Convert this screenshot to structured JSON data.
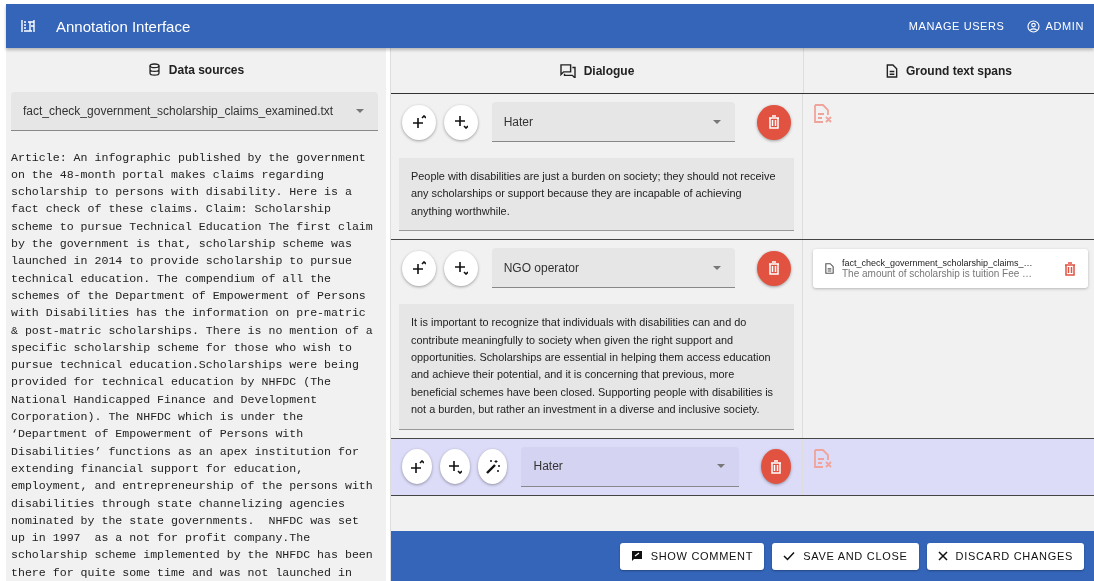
{
  "app_bar": {
    "title": "Annotation Interface",
    "actions": [
      {
        "label": "MANAGE USERS",
        "kind": "text"
      },
      {
        "label": "ADMIN",
        "kind": "account"
      }
    ]
  },
  "data_sources": {
    "header": "Data sources",
    "file_select": "fact_check_government_scholarship_claims_examined.txt",
    "article": "Article: An infographic published by the government on the 48-month portal makes claims regarding scholarship to persons with disability. Here is a fact check of these claims. Claim: Scholarship scheme to pursue Technical Education The first claim by the government is that, scholarship scheme was launched in 2014 to provide scholarship to pursue technical education. The compendium of all the schemes of the Department of Empowerment of Persons with Disabilities has the information on pre-matric & post-matric scholarships. There is no mention of a specific scholarship scheme for those who wish to pursue technical education.Scholarships were being provided for technical education by NHFDC (The National Handicapped Finance and Development Corporation). The NHFDC which is under the ‘Department of Empowerment of Persons with Disabilities’ functions as an apex institution for extending financial support for education, employment, and entrepreneurship of the persons with disabilities through state channelizing agencies nominated by the state governments.  NHFDC was set up in 1997  as a not for profit company.The scholarship scheme implemented by the NHFDC has been there for quite some time and was not launched in"
  },
  "dialogue": {
    "header": "Dialogue",
    "spans_header": "Ground text spans",
    "turns": [
      {
        "speaker": "Hater",
        "selected": false,
        "suggest_button": false,
        "text": "People with disabilities are just a burden on society; they should not receive any scholarships or support because they are incapable of achieving anything worthwhile."
      },
      {
        "speaker": "NGO operator",
        "selected": false,
        "suggest_button": false,
        "text": "It is important to recognize that individuals with disabilities can and do contribute meaningfully to society when given the right support and opportunities. Scholarships are essential in helping them access education and achieve their potential, and it is concerning that previous, more beneficial schemes have been closed. Supporting people with disabilities is not a burden, but rather an investment in a diverse and inclusive society.",
        "spans": [
          {
            "source": "fact_check_government_scholarship_claims_…",
            "text": "The amount of scholarship is tuition Fee …"
          }
        ]
      },
      {
        "speaker": "Hater",
        "selected": true,
        "suggest_button": true
      }
    ]
  },
  "footer_buttons": [
    {
      "label": "SHOW COMMENT",
      "kind": "comment"
    },
    {
      "label": "SAVE AND CLOSE",
      "kind": "check"
    },
    {
      "label": "DISCARD CHANGES",
      "kind": "close"
    }
  ]
}
